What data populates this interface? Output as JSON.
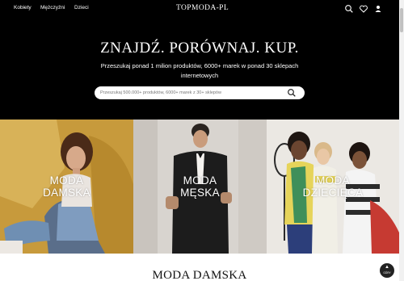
{
  "nav": {
    "links": [
      "Kobiety",
      "Mężczyźni",
      "Dzieci"
    ],
    "logo": "TOPMODA-PL",
    "icons": [
      "search-icon",
      "heart-icon",
      "user-icon"
    ]
  },
  "hero": {
    "title": "ZNAJDŹ. PORÓWNAJ. KUP.",
    "subtitle": "Przeszukaj ponad 1 milion produktów, 6000+ marek w ponad 30 sklepach internetowych",
    "search_placeholder": "Przeszukaj 500.000+ produktów, 6000+ marek z 30+ sklepów"
  },
  "categories": [
    {
      "line1": "MODA",
      "line2": "DAMSKA"
    },
    {
      "line1": "MODA",
      "line2": "MĘSKA"
    },
    {
      "line1": "MODA",
      "line2": "DZIECIĘCA"
    }
  ],
  "section": {
    "title": "MODA DAMSKA"
  },
  "back_to_top": {
    "label": "GÓRY"
  },
  "colors": {
    "accent": "#000000",
    "panel_women": "#c9a24a",
    "panel_men": "#d9d6d2",
    "panel_kids": "#e9e6e1"
  }
}
